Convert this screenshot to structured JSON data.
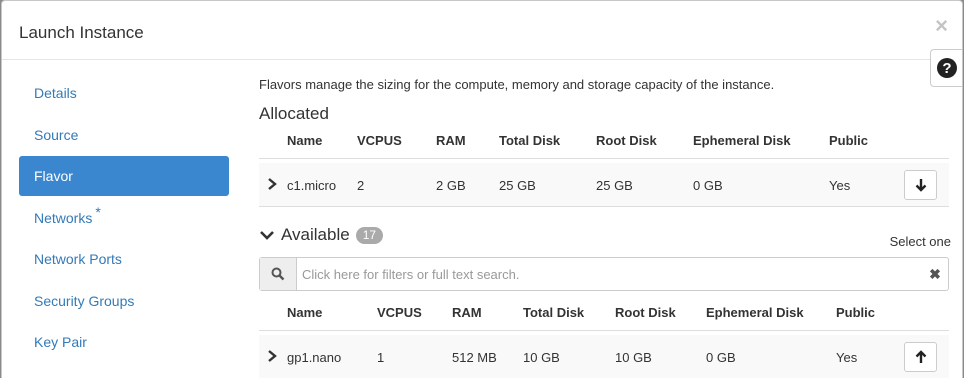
{
  "modal": {
    "title": "Launch Instance",
    "close_glyph": "×",
    "help_glyph": "?"
  },
  "nav": {
    "items": [
      {
        "label": "Details",
        "active": false,
        "required": false
      },
      {
        "label": "Source",
        "active": false,
        "required": false
      },
      {
        "label": "Flavor",
        "active": true,
        "required": false
      },
      {
        "label": "Networks",
        "active": false,
        "required": true,
        "required_mark": "*"
      },
      {
        "label": "Network Ports",
        "active": false,
        "required": false
      },
      {
        "label": "Security Groups",
        "active": false,
        "required": false
      },
      {
        "label": "Key Pair",
        "active": false,
        "required": false
      }
    ]
  },
  "flavor": {
    "description": "Flavors manage the sizing for the compute, memory and storage capacity of the instance.",
    "allocated": {
      "title": "Allocated",
      "columns": [
        "Name",
        "VCPUS",
        "RAM",
        "Total Disk",
        "Root Disk",
        "Ephemeral Disk",
        "Public"
      ],
      "rows": [
        {
          "name": "c1.micro",
          "vcpus": "2",
          "ram": "2 GB",
          "total_disk": "25 GB",
          "root_disk": "25 GB",
          "ephemeral_disk": "0 GB",
          "public": "Yes"
        }
      ]
    },
    "available": {
      "title": "Available",
      "count": "17",
      "select_hint": "Select one",
      "search_placeholder": "Click here for filters or full text search.",
      "clear_glyph": "✖",
      "columns": [
        "Name",
        "VCPUS",
        "RAM",
        "Total Disk",
        "Root Disk",
        "Ephemeral Disk",
        "Public"
      ],
      "rows": [
        {
          "name": "gp1.nano",
          "vcpus": "1",
          "ram": "512 MB",
          "total_disk": "10 GB",
          "root_disk": "10 GB",
          "ephemeral_disk": "0 GB",
          "public": "Yes"
        }
      ]
    }
  },
  "colors": {
    "accent": "#3a87d0",
    "link": "#337ab7",
    "badge": "#aaaaaa"
  },
  "icons": {
    "close": "close-icon",
    "help": "question-icon",
    "expand": "chevron-right-icon",
    "collapse": "chevron-down-icon",
    "deallocate": "arrow-down-icon",
    "allocate": "arrow-up-icon",
    "search": "search-icon",
    "clear": "clear-icon"
  }
}
